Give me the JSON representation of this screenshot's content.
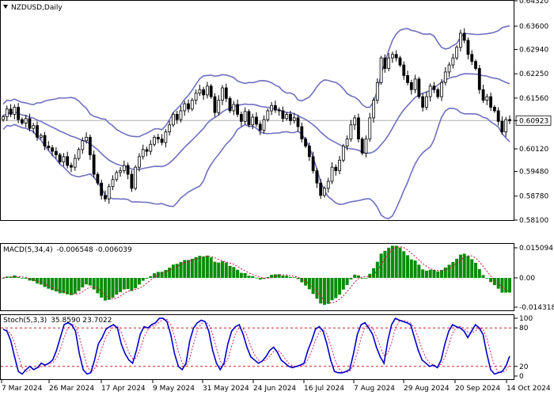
{
  "colors": {
    "background": "#ffffff",
    "candle": "#000000",
    "bollinger": "#6f6fc2",
    "macd_hist": "#0a8c0a",
    "macd_signal": "#c01040",
    "stoch_k": "#0000c8",
    "stoch_d": "#d0206a",
    "level_line": "#d02020",
    "price_line": "#b0b0b0",
    "price_label_bg": "#ffffff"
  },
  "header": {
    "dropdown_icon": "triangle-down-icon",
    "symbol_label": "NZDUSD,Daily"
  },
  "x_axis": {
    "dates": [
      "7 Mar 2024",
      "26 Mar 2024",
      "17 Apr 2024",
      "9 May 2024",
      "31 May 2024",
      "24 Jun 2024",
      "16 Jul 2024",
      "7 Aug 2024",
      "29 Aug 2024",
      "20 Sep 2024",
      "14 Oct 2024"
    ]
  },
  "chart_data": [
    {
      "type": "candlestick",
      "title": "NZDUSD,Daily",
      "ylim": [
        0.581,
        0.6432
      ],
      "y_ticks": [
        "0.64320",
        "0.63600",
        "0.62940",
        "0.62250",
        "0.61560",
        "0.60923",
        "0.60120",
        "0.59480",
        "0.58780",
        "0.58100"
      ],
      "current_price": 0.60923,
      "current_price_label": "0.60923",
      "close_series": [
        0.6103,
        0.6125,
        0.611,
        0.613,
        0.6095,
        0.6085,
        0.6098,
        0.607,
        0.6078,
        0.6045,
        0.605,
        0.602,
        0.6015,
        0.6005,
        0.5995,
        0.5975,
        0.599,
        0.5965,
        0.596,
        0.5985,
        0.601,
        0.6035,
        0.6045,
        0.5995,
        0.594,
        0.5915,
        0.588,
        0.587,
        0.5905,
        0.5925,
        0.5945,
        0.595,
        0.5965,
        0.594,
        0.59,
        0.596,
        0.599,
        0.601,
        0.6005,
        0.6025,
        0.6045,
        0.604,
        0.603,
        0.606,
        0.608,
        0.611,
        0.6095,
        0.612,
        0.614,
        0.6125,
        0.615,
        0.617,
        0.618,
        0.6165,
        0.619,
        0.616,
        0.6115,
        0.615,
        0.6185,
        0.6155,
        0.612,
        0.6138,
        0.611,
        0.609,
        0.6118,
        0.608,
        0.6102,
        0.6082,
        0.6065,
        0.6095,
        0.612,
        0.6135,
        0.6122,
        0.612,
        0.6098,
        0.611,
        0.6092,
        0.61,
        0.6075,
        0.604,
        0.602,
        0.599,
        0.595,
        0.5915,
        0.588,
        0.59,
        0.592,
        0.596,
        0.595,
        0.598,
        0.602,
        0.604,
        0.608,
        0.61,
        0.604,
        0.6,
        0.604,
        0.61,
        0.615,
        0.62,
        0.627,
        0.624,
        0.627,
        0.628,
        0.627,
        0.625,
        0.622,
        0.62,
        0.618,
        0.621,
        0.616,
        0.613,
        0.616,
        0.619,
        0.618,
        0.616,
        0.62,
        0.623,
        0.625,
        0.627,
        0.63,
        0.634,
        0.632,
        0.628,
        0.626,
        0.624,
        0.618,
        0.615,
        0.616,
        0.613,
        0.612,
        0.609,
        0.606,
        0.6095,
        0.6092
      ],
      "bollinger": {
        "mid": "20-period moving average of close_series",
        "upper": "mid + 2 standard deviations",
        "lower": "mid - 2 standard deviations"
      }
    },
    {
      "type": "bar",
      "title": "MACD(5,34,4) -0.006548 -0.006039",
      "label": "MACD(5,34,4)",
      "values_text": "-0.006548 -0.006039",
      "ylim": [
        -0.01438,
        0.01509
      ],
      "y_ticks": [
        "0.015094",
        "0.00",
        "-0.014318"
      ],
      "series": [
        {
          "name": "MACD",
          "values": "EMA(5) - EMA(34) of close_series"
        },
        {
          "name": "Signal",
          "values": "SMA(4) of MACD"
        }
      ],
      "last_values": [
        -0.006548,
        -0.006039
      ]
    },
    {
      "type": "line",
      "title": "Stoch(5,3,3) 35.8590 23.7022",
      "label": "Stoch(5,3,3)",
      "values_text": "35.8590 23.7022",
      "ylim": [
        0,
        100
      ],
      "y_ticks": [
        "100",
        "80",
        "20",
        "0"
      ],
      "levels": [
        80,
        20
      ],
      "series": [
        {
          "name": "%K",
          "values": [
            78,
            75,
            60,
            35,
            12,
            8,
            15,
            20,
            15,
            18,
            25,
            22,
            25,
            30,
            45,
            65,
            85,
            88,
            85,
            75,
            40,
            15,
            8,
            10,
            30,
            55,
            65,
            78,
            82,
            85,
            80,
            55,
            40,
            30,
            25,
            45,
            70,
            82,
            80,
            85,
            88,
            95,
            95,
            90,
            70,
            40,
            20,
            15,
            25,
            60,
            80,
            88,
            92,
            90,
            75,
            45,
            25,
            15,
            25,
            55,
            75,
            82,
            85,
            70,
            50,
            35,
            30,
            25,
            28,
            35,
            45,
            50,
            42,
            30,
            25,
            20,
            18,
            20,
            22,
            25,
            45,
            60,
            78,
            82,
            75,
            55,
            30,
            12,
            10,
            10,
            12,
            15,
            40,
            70,
            85,
            88,
            80,
            70,
            50,
            35,
            25,
            60,
            85,
            95,
            92,
            90,
            88,
            85,
            65,
            45,
            30,
            25,
            20,
            22,
            18,
            30,
            55,
            75,
            85,
            82,
            80,
            75,
            65,
            75,
            85,
            80,
            70,
            40,
            15,
            8,
            10,
            12,
            20,
            36
          ]
        },
        {
          "name": "%D",
          "values": "3-period moving average of %K"
        }
      ],
      "last_values": [
        35.859,
        23.7022
      ]
    }
  ]
}
